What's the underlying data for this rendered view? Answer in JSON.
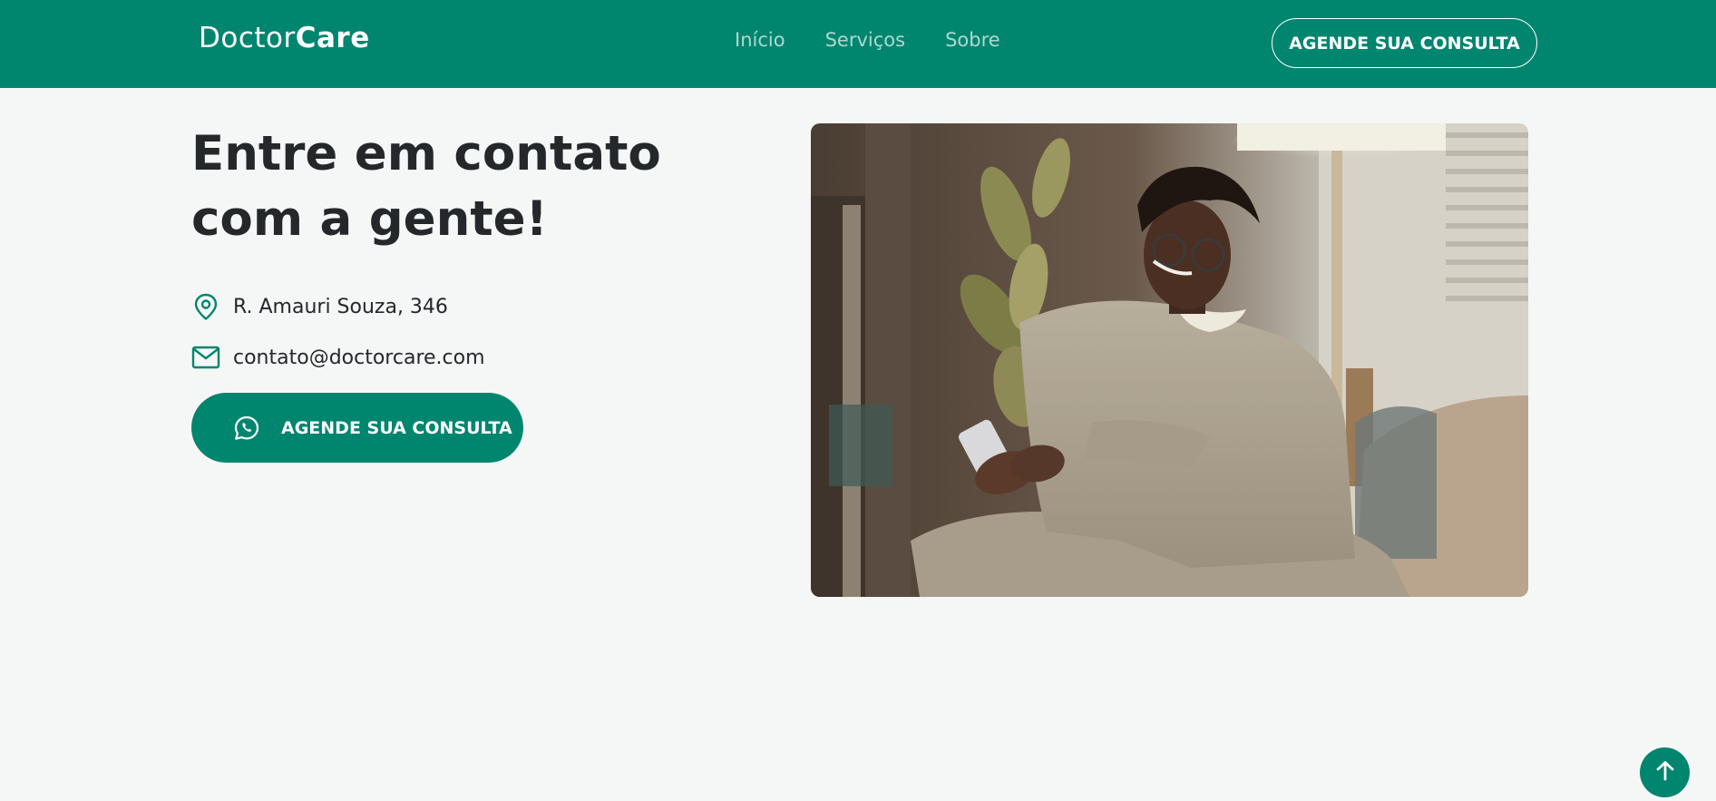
{
  "header": {
    "logo_regular": "Doctor",
    "logo_bold": "Care",
    "nav": [
      {
        "label": "Início"
      },
      {
        "label": "Serviços"
      },
      {
        "label": "Sobre"
      }
    ],
    "cta_label": "AGENDE SUA CONSULTA"
  },
  "contact": {
    "title_line1": "Entre em contato",
    "title_line2": "com a gente!",
    "address": "R. Amauri Souza, 346",
    "email": "contato@doctorcare.com",
    "cta_label": "AGENDE SUA CONSULTA"
  },
  "image": {
    "subject": "person-smiling-using-phone"
  },
  "icons": {
    "location": "map-pin-icon",
    "email": "envelope-icon",
    "whatsapp": "whatsapp-icon",
    "back_to_top": "arrow-up-icon"
  },
  "colors": {
    "brand": "#00856F",
    "background": "#F5F7F6",
    "text": "#25282B"
  }
}
